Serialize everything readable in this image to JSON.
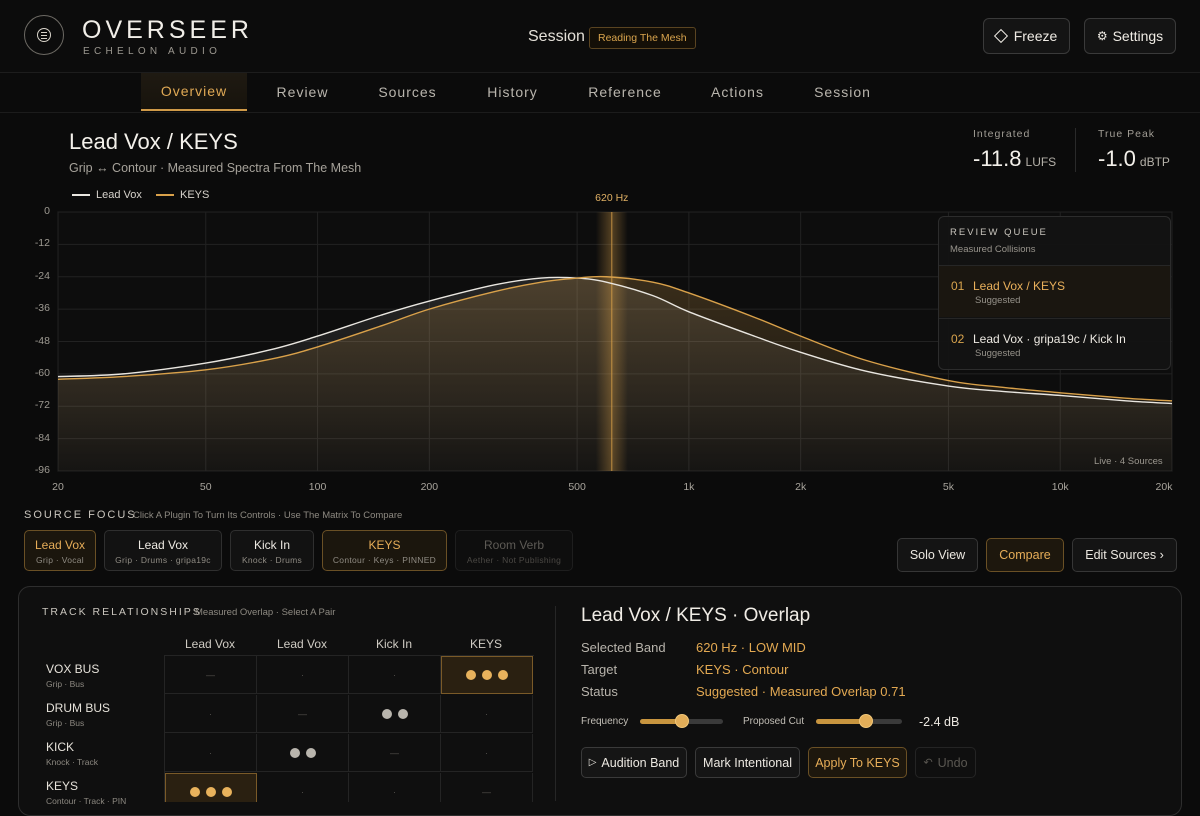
{
  "app": {
    "brand": "OVERSEER",
    "sub_brand": "ECHELON AUDIO",
    "session_label": "Session",
    "session_name": "Reading The Mesh",
    "freeze_label": "Freeze",
    "settings_label": "Settings"
  },
  "tabs": [
    "Overview",
    "Review",
    "Sources",
    "History",
    "Reference",
    "Actions",
    "Session"
  ],
  "active_tab": "Overview",
  "main": {
    "title": "Lead Vox / KEYS",
    "subtitle": "Grip ↔ Contour · Measured Spectra From The Mesh",
    "integrated_label": "Integrated",
    "integrated_value": "-11.8",
    "integrated_unit": "LUFS",
    "truepeak_label": "True Peak",
    "truepeak_value": "-1.0",
    "truepeak_unit": "dBTP",
    "marker_label": "620 Hz",
    "live_label": "Live · 4 Sources"
  },
  "chart_data": {
    "type": "area",
    "series": [
      {
        "name": "Lead Vox",
        "color": "#e9e6e0",
        "x": [
          20,
          30,
          50,
          75,
          100,
          150,
          200,
          300,
          400,
          500,
          600,
          800,
          1000,
          1500,
          2000,
          3000,
          5000,
          7000,
          10000,
          15000,
          20000
        ],
        "y": [
          -61,
          -60,
          -56,
          -51,
          -46,
          -38,
          -33,
          -27,
          -24.5,
          -24.5,
          -26,
          -31,
          -37,
          -46,
          -52,
          -59,
          -64.5,
          -66.5,
          -68,
          -70,
          -71
        ]
      },
      {
        "name": "KEYS",
        "color": "#d9a14a",
        "x": [
          20,
          30,
          50,
          75,
          100,
          150,
          200,
          300,
          400,
          500,
          600,
          800,
          1000,
          1500,
          2000,
          3000,
          5000,
          7000,
          10000,
          15000,
          20000
        ],
        "y": [
          -62,
          -61,
          -58.5,
          -54.5,
          -50,
          -42,
          -36,
          -29.5,
          -26,
          -24.5,
          -24,
          -26,
          -30,
          -39,
          -46,
          -55,
          -62.5,
          -65,
          -67,
          -69,
          -70
        ]
      }
    ],
    "x_scale": "log",
    "xlim": [
      20,
      20000
    ],
    "ylim": [
      -96,
      0
    ],
    "yticks": [
      0,
      -12,
      -24,
      -36,
      -48,
      -60,
      -72,
      -84,
      -96
    ],
    "xticks": [
      20,
      50,
      100,
      200,
      500,
      1000,
      2000,
      5000,
      10000,
      20000
    ],
    "xtick_labels": [
      "20",
      "50",
      "100",
      "200",
      "500",
      "1k",
      "2k",
      "5k",
      "10k",
      "20k"
    ],
    "marker_x": 620,
    "grid": true,
    "legend": "top-left"
  },
  "review_queue": {
    "title": "REVIEW QUEUE",
    "subtitle": "Measured Collisions",
    "items": [
      {
        "num": "01",
        "name": "Lead Vox / KEYS",
        "status": "Suggested"
      },
      {
        "num": "02",
        "name": "Lead Vox · gripa19c / Kick In",
        "status": "Suggested"
      }
    ]
  },
  "source_focus": {
    "title": "SOURCE FOCUS",
    "hint": "Click A Plugin To Turn Its Controls · Use The Matrix To Compare",
    "sources": [
      {
        "name": "Lead Vox",
        "meta": "Grip · Vocal"
      },
      {
        "name": "Lead Vox",
        "meta": "Grip · Drums · gripa19c"
      },
      {
        "name": "Kick In",
        "meta": "Knock · Drums"
      },
      {
        "name": "KEYS",
        "meta": "Contour · Keys · PINNED"
      },
      {
        "name": "Room Verb",
        "meta": "Aether · Not Publishing"
      }
    ],
    "solo_view": "Solo View",
    "compare": "Compare",
    "edit_sources": "Edit Sources ›"
  },
  "relationships": {
    "title": "TRACK RELATIONSHIPS",
    "hint": "Measured Overlap · Select A Pair",
    "columns": [
      "Lead Vox",
      "Lead Vox",
      "Kick In",
      "KEYS"
    ],
    "rows": [
      {
        "name": "VOX BUS",
        "meta": "Grip · Bus"
      },
      {
        "name": "DRUM BUS",
        "meta": "Grip · Bus"
      },
      {
        "name": "KICK",
        "meta": "Knock · Track"
      },
      {
        "name": "KEYS",
        "meta": "Contour · Track · PIN"
      }
    ],
    "cell_marks": [
      "—",
      "·"
    ]
  },
  "overlap": {
    "title": "Lead Vox / KEYS · Overlap",
    "selected_band_label": "Selected Band",
    "selected_band_value": "620 Hz · LOW MID",
    "target_label": "Target",
    "target_value": "KEYS · Contour",
    "status_label": "Status",
    "status_value": "Suggested · Measured Overlap 0.71",
    "frequency_label": "Frequency",
    "frequency_level": 0.5,
    "cut_label": "Proposed Cut",
    "cut_level": 0.58,
    "cut_value": "-2.4 dB",
    "audition": "Audition Band",
    "mark_intentional": "Mark Intentional",
    "apply": "Apply To KEYS",
    "undo": "Undo"
  }
}
